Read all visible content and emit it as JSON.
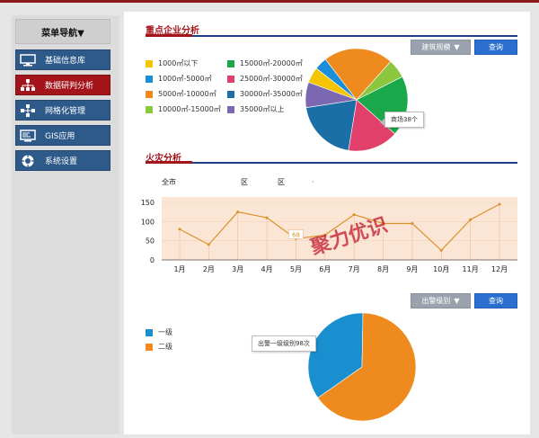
{
  "sidebar": {
    "header": "菜单导航▼",
    "items": [
      {
        "label": "基础信息库",
        "icon": "monitor-icon",
        "active": false
      },
      {
        "label": "数据研判分析",
        "icon": "org-chart-icon",
        "active": true
      },
      {
        "label": "网格化管理",
        "icon": "grid-icon",
        "active": false
      },
      {
        "label": "GIS应用",
        "icon": "gis-screen-icon",
        "active": false
      },
      {
        "label": "系统设置",
        "icon": "settings-icon",
        "active": false
      }
    ]
  },
  "enterprise": {
    "title": "重点企业分析",
    "filter_label": "建筑规模",
    "query_label": "查询",
    "legend": [
      {
        "label": "1000㎡以下",
        "color": "#f5c400"
      },
      {
        "label": "15000㎡-20000㎡",
        "color": "#1aa84b"
      },
      {
        "label": "1000㎡-5000㎡",
        "color": "#1a8fd8"
      },
      {
        "label": "25000㎡-30000㎡",
        "color": "#e0406a"
      },
      {
        "label": "5000㎡-10000㎡",
        "color": "#ee8a1e"
      },
      {
        "label": "30000㎡-35000㎡",
        "color": "#1b6ea6"
      },
      {
        "label": "10000㎡-15000㎡",
        "color": "#8cc63f"
      },
      {
        "label": "35000㎡以上",
        "color": "#7b68b0"
      }
    ],
    "tooltip": "商场38个"
  },
  "fire": {
    "title": "火灾分析",
    "region_all": "全市",
    "region_a": "区",
    "region_b": "区",
    "point_label": "68"
  },
  "watermark": "聚力优识",
  "level": {
    "filter_label": "出警级别",
    "query_label": "查询",
    "legend": [
      {
        "label": "一级",
        "color": "#1a8fd0"
      },
      {
        "label": "二级",
        "color": "#ee8a1e"
      }
    ],
    "tooltip": "出警一级级别98次"
  },
  "chart_data": [
    {
      "type": "pie",
      "title": "重点企业分析",
      "labels": [
        "1000㎡以下",
        "1000㎡-5000㎡",
        "5000㎡-10000㎡",
        "10000㎡-15000㎡",
        "15000㎡-20000㎡",
        "25000㎡-30000㎡",
        "30000㎡-35000㎡",
        "35000㎡以上"
      ],
      "values": [
        5,
        4,
        22,
        6,
        19,
        16,
        20,
        8
      ],
      "colors": [
        "#f5c400",
        "#1a8fd8",
        "#ee8a1e",
        "#8cc63f",
        "#1aa84b",
        "#e0406a",
        "#1b6ea6",
        "#7b68b0"
      ]
    },
    {
      "type": "line",
      "title": "火灾分析",
      "categories": [
        "1月",
        "2月",
        "3月",
        "4月",
        "5月",
        "6月",
        "7月",
        "8月",
        "9月",
        "10月",
        "11月",
        "12月"
      ],
      "series": [
        {
          "values": [
            80,
            40,
            125,
            110,
            55,
            65,
            118,
            95,
            95,
            25,
            105,
            145
          ]
        }
      ],
      "yticks": [
        0,
        50,
        100,
        150
      ],
      "ylim": [
        0,
        150
      ],
      "color": "#d9932a",
      "background": "#fbe6d6"
    },
    {
      "type": "pie",
      "labels": [
        "一级",
        "二级"
      ],
      "values": [
        35,
        65
      ],
      "colors": [
        "#1a8fd0",
        "#ee8a1e"
      ]
    }
  ]
}
